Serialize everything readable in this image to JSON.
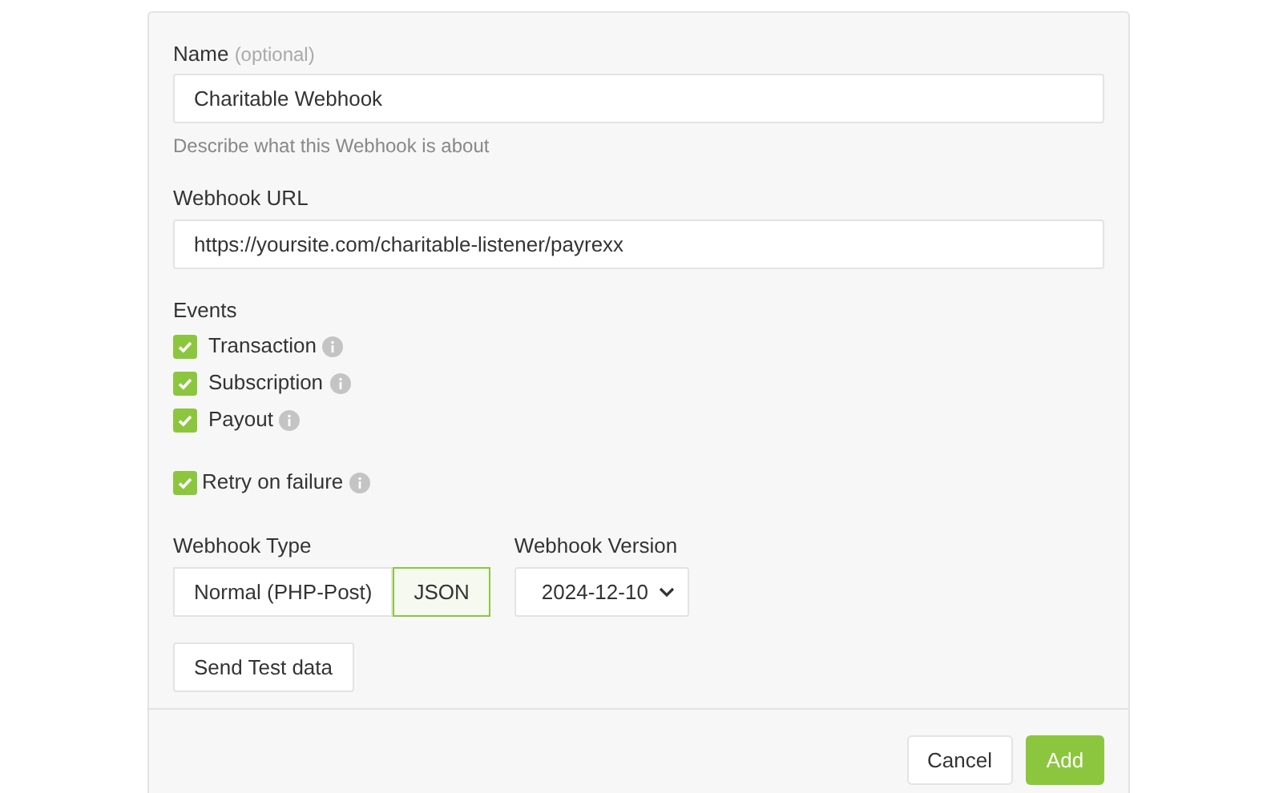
{
  "name_field": {
    "label": "Name",
    "optional": "(optional)",
    "value": "Charitable Webhook",
    "hint": "Describe what this Webhook is about"
  },
  "url_field": {
    "label": "Webhook URL",
    "value": "https://yoursite.com/charitable-listener/payrexx"
  },
  "events": {
    "label": "Events",
    "items": [
      {
        "label": "Transaction",
        "checked": true
      },
      {
        "label": "Subscription",
        "checked": true
      },
      {
        "label": "Payout",
        "checked": true
      }
    ]
  },
  "retry": {
    "label": "Retry on failure",
    "checked": true
  },
  "webhook_type": {
    "label": "Webhook Type",
    "options": [
      {
        "label": "Normal (PHP-Post)",
        "selected": false
      },
      {
        "label": "JSON",
        "selected": true
      }
    ]
  },
  "webhook_version": {
    "label": "Webhook Version",
    "value": "2024-12-10"
  },
  "test_button": "Send Test data",
  "footer": {
    "cancel": "Cancel",
    "add": "Add"
  }
}
